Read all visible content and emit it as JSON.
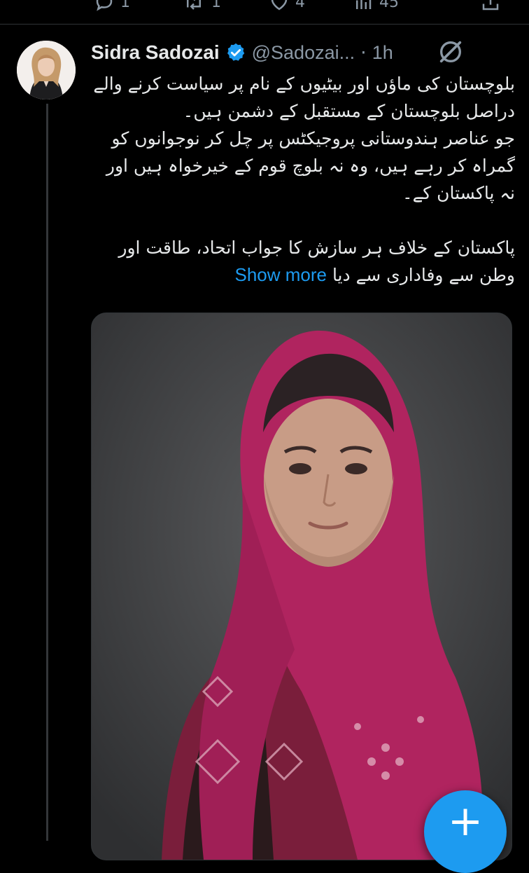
{
  "prev_actions": {
    "reply_count": "1",
    "retweet_count": "1",
    "like_count": "4",
    "views_count": "45"
  },
  "tweet": {
    "author_name": "Sidra Sadozai",
    "handle": "@Sadozai...",
    "separator": "·",
    "time": "1h",
    "verified": true,
    "text_lines": [
      "بلوچستان کی ماؤں اور بیٹیوں کے نام پر سیاست کرنے والے دراصل بلوچستان کے مستقبل کے دشمن ہیں۔",
      "جو عناصر ہندوستانی پروجیکٹس پر چل کر نوجوانوں کو گمراہ کر رہے ہیں، وہ نہ بلوچ قوم کے خیرخواہ ہیں اور نہ پاکستان کے۔",
      "پاکستان کے خلاف ہر سازش کا جواب اتحاد، طاقت اور وطن سے وفاداری سے دیا"
    ],
    "show_more": "Show more"
  },
  "icons": {
    "reply": "reply-icon",
    "retweet": "retweet-icon",
    "like": "heart-icon",
    "views": "views-icon",
    "share": "share-icon",
    "verified": "verified-badge-icon",
    "grok": "grok-icon",
    "compose": "plus-icon"
  },
  "colors": {
    "background": "#000000",
    "text": "#e7e9ea",
    "secondary": "#8b98a5",
    "accent": "#1d9bf0",
    "media_scarf": "#b0245f"
  },
  "fab": {
    "label": "+"
  }
}
